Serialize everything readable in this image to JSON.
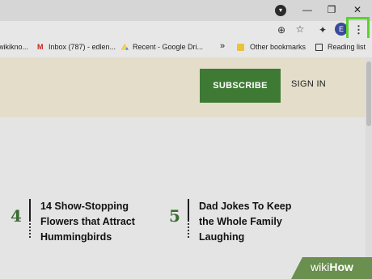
{
  "browser": {
    "bookmarks": [
      {
        "label": "wikikno...",
        "icon": "wikihow-favicon"
      },
      {
        "label": "Inbox (787) - edlen...",
        "icon": "gmail-icon"
      },
      {
        "label": "Recent - Google Dri...",
        "icon": "google-drive-icon"
      }
    ],
    "more_bookmarks": "»",
    "other_bookmarks": "Other bookmarks",
    "reading_list": "Reading list",
    "profile_initial": "E"
  },
  "site": {
    "subscribe_label": "SUBSCRIBE",
    "signin_label": "SIGN IN",
    "articles": [
      {
        "number": "4",
        "title_lines": [
          "14 Show-Stopping",
          "Flowers that Attract",
          "Hummingbirds"
        ]
      },
      {
        "number": "5",
        "title_lines": [
          "Dad Jokes To Keep",
          "the Whole Family",
          "Laughing"
        ]
      }
    ]
  },
  "watermark": {
    "part1": "wiki",
    "part2": "How"
  },
  "colors": {
    "subscribe_bg": "#3f7a35",
    "accent_green": "#3b6a33",
    "highlight": "#5bd12f"
  }
}
